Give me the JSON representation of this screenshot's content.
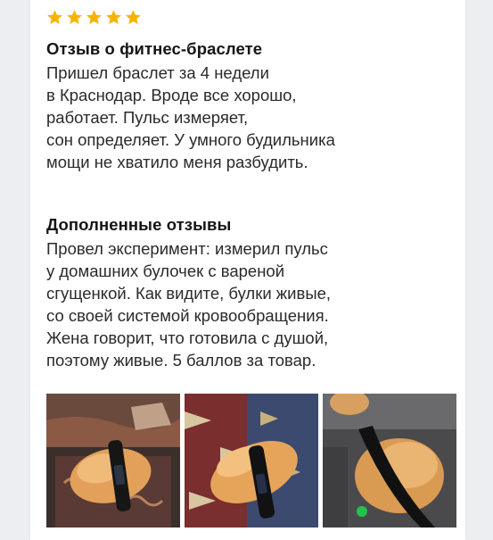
{
  "review": {
    "rating": 5,
    "rating_max": 5,
    "star_color": "#f6b400",
    "title": "Отзыв о фитнес-браслете",
    "lines": [
      "Пришел браслет за 4 недели",
      "в Краснодар. Вроде все хорошо,",
      "работает. Пульс измеряет,",
      "сон определяет. У умного будильника",
      "мощи не хватило меня разбудить."
    ]
  },
  "additional": {
    "title": "Дополненные отзывы",
    "lines": [
      "Провел эксперимент: измерил пульс",
      "у домашних булочек с вареной",
      "сгущенкой. Как видите, булки живые,",
      "со своей системой кровообращения.",
      "Жена говорит, что готовила с душой,",
      "поэтому живые. 5 баллов за товар."
    ]
  },
  "photos": [
    {
      "icon": "photo-bun-with-bracelet"
    },
    {
      "icon": "photo-bun-with-bracelet"
    },
    {
      "icon": "photo-bun-with-bracelet-closeup"
    }
  ]
}
